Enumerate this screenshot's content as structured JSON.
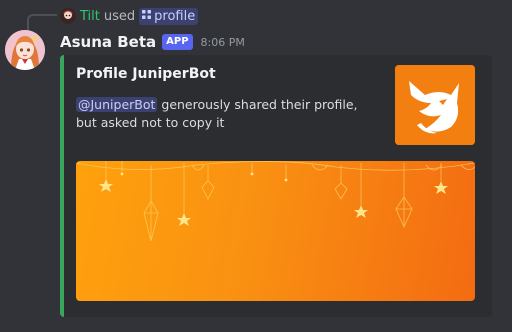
{
  "reply": {
    "user": "Tilt",
    "action": "used",
    "command": "profile"
  },
  "message": {
    "author": "Asuna Beta",
    "badge": "APP",
    "timestamp": "8:06 PM"
  },
  "embed": {
    "accent_color": "#3ba55d",
    "title": "Profile JuniperBot",
    "mention": "@JuniperBot",
    "description": " generously shared their profile, but asked not to copy it",
    "thumbnail_icon": "fox-logo-icon",
    "banner": "starry-orange-banner"
  },
  "colors": {
    "background": "#313338",
    "embed_bg": "#2b2d31",
    "brand": "#5865f2",
    "banner_orange": "#f99012"
  }
}
